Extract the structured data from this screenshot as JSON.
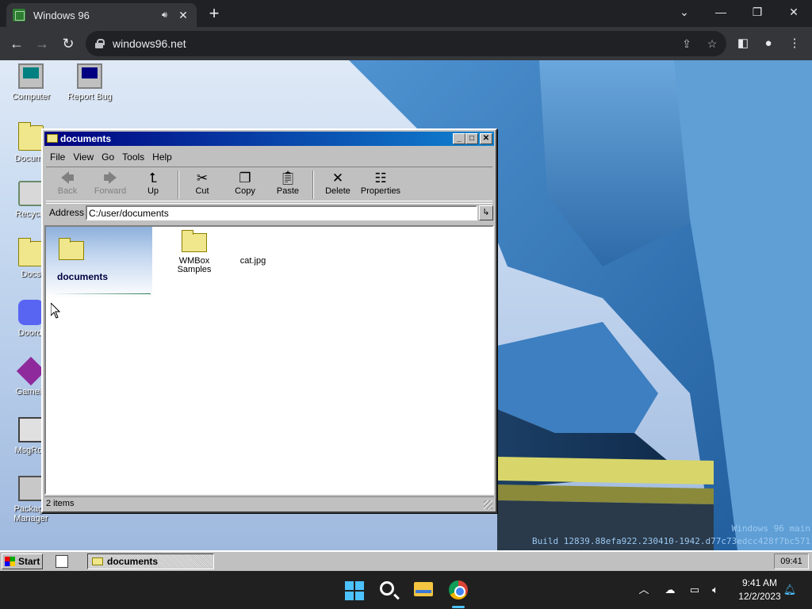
{
  "browser": {
    "tab_title": "Windows 96",
    "url": "windows96.net"
  },
  "desktop": {
    "icons": [
      {
        "label": "Computer"
      },
      {
        "label": "Report Bug"
      },
      {
        "label": "Docume"
      },
      {
        "label": "Recycle"
      },
      {
        "label": "Docs"
      },
      {
        "label": "Doordi"
      },
      {
        "label": "Gamein"
      },
      {
        "label": "MsgRoo"
      },
      {
        "label": "Package Manager"
      }
    ],
    "build_line1": "Windows 96 main",
    "build_line2": "Build 12839.88efa922.230410-1942.d77c73edcc428f7bc571"
  },
  "explorer": {
    "title": "documents",
    "menu": [
      "File",
      "View",
      "Go",
      "Tools",
      "Help"
    ],
    "toolbar": {
      "back": "Back",
      "forward": "Forward",
      "up": "Up",
      "cut": "Cut",
      "copy": "Copy",
      "paste": "Paste",
      "delete": "Delete",
      "properties": "Properties"
    },
    "address_label": "Address",
    "address_value": "C:/user/documents",
    "side_title": "documents",
    "items": [
      {
        "name": "WMBox Samples",
        "type": "folder"
      },
      {
        "name": "cat.jpg",
        "type": "file"
      }
    ],
    "status": "2 items"
  },
  "w96_taskbar": {
    "start": "Start",
    "task": "documents",
    "clock": "09:41"
  },
  "os_taskbar": {
    "time": "9:41 AM",
    "date": "12/2/2023"
  }
}
